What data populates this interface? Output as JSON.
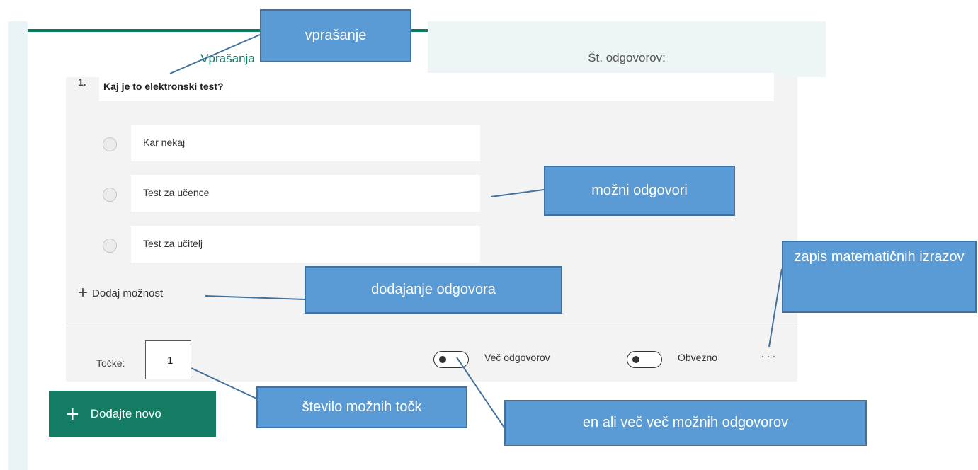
{
  "tabs": {
    "questions": "Vprašanja",
    "responses": "Št. odgovorov:"
  },
  "question": {
    "number": "1.",
    "title": "Kaj je to elektronski test?",
    "options": [
      "Kar nekaj",
      "Test  za učence",
      "Test za učitelj"
    ],
    "add_option": "Dodaj možnost"
  },
  "footer": {
    "points_label": "Točke:",
    "points_value": "1",
    "multiple_answers_label": "Več odgovorov",
    "required_label": "Obvezno",
    "more_glyph": "···"
  },
  "add_new_label": "Dodajte novo",
  "callouts": {
    "question": "vprašanje",
    "possible_answers": "možni odgovori",
    "math": "zapis  matematičnih izrazov",
    "add_answer": "dodajanje odgovora",
    "points": "število možnih točk",
    "multi": "en ali več več možnih odgovorov"
  },
  "colors": {
    "accent": "#0e7a5f",
    "callout": "#5b9bd5",
    "callout_border": "#41719c"
  }
}
